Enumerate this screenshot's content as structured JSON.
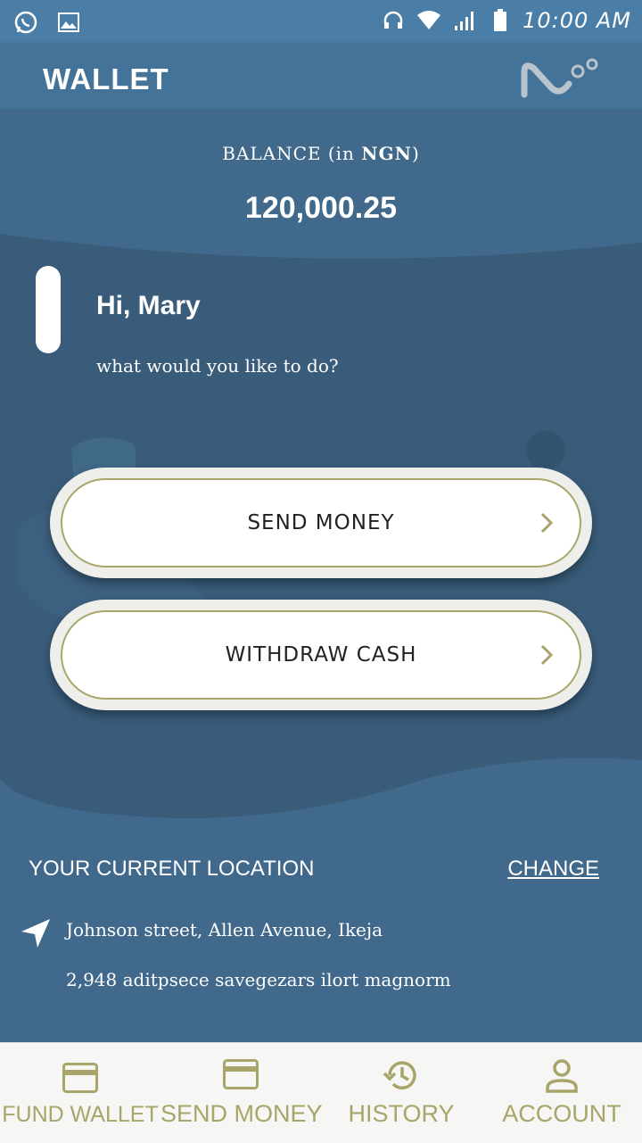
{
  "status_bar": {
    "time": "10:00 AM",
    "icons": [
      "whatsapp-icon",
      "image-icon",
      "headset-icon",
      "wifi-icon",
      "signal-icon",
      "battery-icon"
    ]
  },
  "app_bar": {
    "title": "WALLET",
    "logo_icon": "brand-logo-icon"
  },
  "balance": {
    "label_prefix": "BALANCE (in ",
    "currency": "NGN",
    "label_suffix": ")",
    "amount": "120,000.25"
  },
  "greeting": {
    "name_line": "Hi, Mary",
    "prompt": "what would you like to do?"
  },
  "actions": [
    {
      "label": "SEND MONEY"
    },
    {
      "label": "WITHDRAW CASH"
    }
  ],
  "location": {
    "title": "YOUR CURRENT LOCATION",
    "change_label": "CHANGE",
    "address": "Johnson street, Allen Avenue, Ikeja",
    "detail": "2,948 aditpsece savegezars ilort magnorm"
  },
  "bottom_nav": [
    {
      "label": "FUND WALLET",
      "icon": "card-icon"
    },
    {
      "label": "SEND MONEY",
      "icon": "card-icon"
    },
    {
      "label": "HISTORY",
      "icon": "history-icon"
    },
    {
      "label": "ACCOUNT",
      "icon": "person-icon"
    }
  ],
  "colors": {
    "status_bar": "#4a7ea6",
    "app_bar": "#44739a",
    "background": "#41698c",
    "accent_olive": "#a9a56a",
    "nav_bg": "#f6f6f4"
  }
}
